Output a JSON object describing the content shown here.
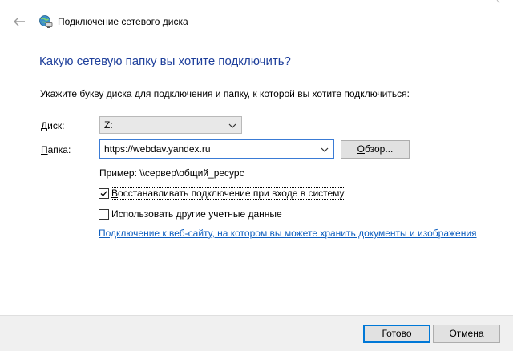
{
  "header": {
    "title": "Подключение сетевого диска"
  },
  "main": {
    "heading": "Какую сетевую папку вы хотите подключить?",
    "instruction": "Укажите букву диска для подключения и папку, к которой вы хотите подключиться:"
  },
  "drive": {
    "label_ul": "Д",
    "label_rest": "иск:",
    "value": "Z:"
  },
  "folder": {
    "label_ul": "П",
    "label_rest": "апка:",
    "value": "https://webdav.yandex.ru"
  },
  "browse": {
    "label_ul": "О",
    "label_rest": "бзор..."
  },
  "example": "Пример: \\\\сервер\\общий_ресурс",
  "reconnect": {
    "label_ul": "В",
    "label_rest": "осстанавливать подключение при входе в систему",
    "checked": true
  },
  "other_credentials": {
    "label": "Использовать другие учетные данные",
    "checked": false
  },
  "web_link": "Подключение к веб-сайту, на котором вы можете хранить документы и изображения",
  "footer": {
    "finish_label": "Готово",
    "cancel_label": "Отмена"
  },
  "colors": {
    "heading": "#1e3f9b",
    "link": "#0f5fbf",
    "accent": "#0078d7"
  },
  "icons": {
    "back": "back-arrow-icon",
    "header": "network-drive-icon",
    "dropdown": "chevron-down-icon",
    "check": "checkmark-icon"
  }
}
